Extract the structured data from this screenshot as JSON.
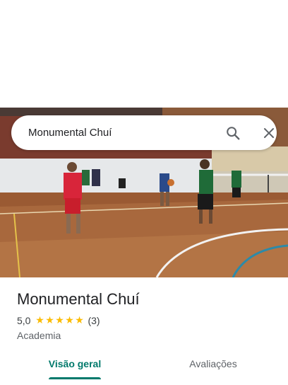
{
  "search": {
    "query": "Monumental Chuí",
    "search_icon": "search-icon",
    "close_icon": "close-icon"
  },
  "place": {
    "photo_alt": "",
    "title": "Monumental Chuí",
    "rating": "5,0",
    "stars": 5,
    "review_count": "(3)",
    "category": "Academia"
  },
  "tabs": [
    {
      "label": "Visão geral",
      "active": true
    },
    {
      "label": "Avaliações",
      "active": false
    }
  ],
  "colors": {
    "accent": "#00796b",
    "star": "#fbbc04"
  }
}
